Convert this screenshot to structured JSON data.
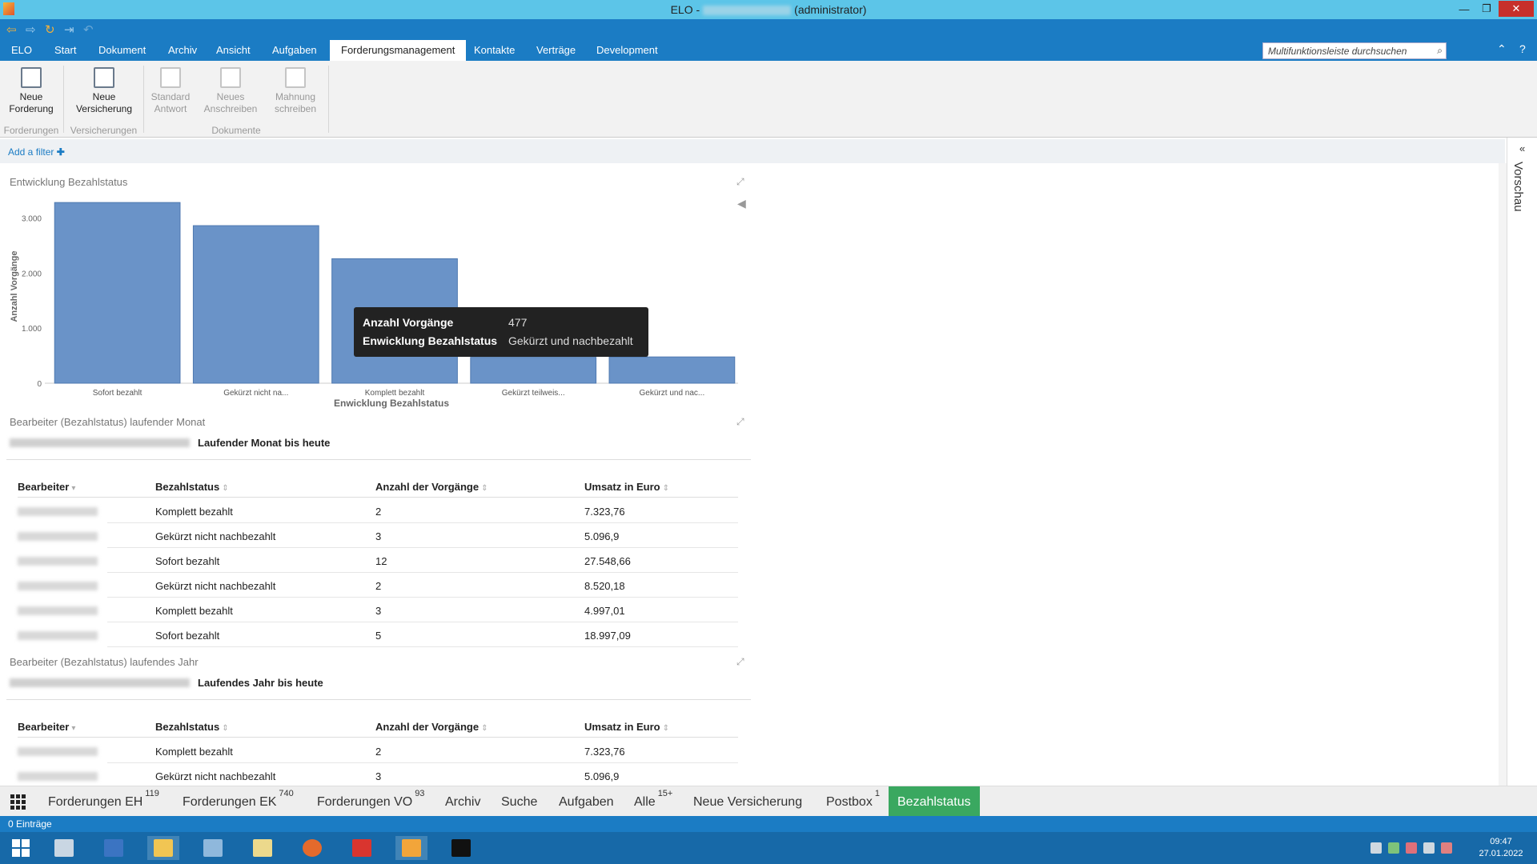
{
  "window": {
    "title_prefix": "ELO -",
    "title_suffix": "(administrator)",
    "minimize": "—",
    "restore": "❐",
    "close": "✕"
  },
  "menu": {
    "tabs": [
      "ELO",
      "Start",
      "Dokument",
      "Archiv",
      "Ansicht",
      "Aufgaben",
      "Forderungsmanagement",
      "Kontakte",
      "Verträge",
      "Development"
    ],
    "active_index": 6,
    "search_placeholder": "Multifunktionsleiste durchsuchen"
  },
  "ribbon": {
    "buttons": [
      {
        "label1": "Neue",
        "label2": "Forderung"
      },
      {
        "label1": "Neue",
        "label2": "Versicherung"
      },
      {
        "label1": "Standard",
        "label2": "Antwort"
      },
      {
        "label1": "Neues",
        "label2": "Anschreiben"
      },
      {
        "label1": "Mahnung",
        "label2": "schreiben"
      }
    ],
    "groups": [
      "Forderungen",
      "Versicherungen",
      "Dokumente"
    ]
  },
  "filter": {
    "add_label": "Add a filter",
    "plus": "✚"
  },
  "preview": {
    "label": "Vorschau",
    "chev": "«"
  },
  "chart_section": {
    "title": "Entwicklung Bezahlstatus"
  },
  "chart_data": {
    "type": "bar",
    "title": "Entwicklung Bezahlstatus",
    "xlabel": "Enwicklung Bezahlstatus",
    "ylabel": "Anzahl Vorgänge",
    "categories": [
      "Sofort bezahlt",
      "Gekürzt nicht na...",
      "Komplett bezahlt",
      "Gekürzt teilweis...",
      "Gekürzt und nac..."
    ],
    "values": [
      3280,
      2860,
      2260,
      470,
      477
    ],
    "yticks": [
      0,
      1000,
      2000,
      3000
    ],
    "ytick_labels": [
      "0",
      "1.000",
      "2.000",
      "3.000"
    ],
    "ylim": [
      0,
      3500
    ],
    "bar_color": "#6a93c8"
  },
  "tooltip": {
    "k1": "Anzahl Vorgänge",
    "v1": "477",
    "k2": "Enwicklung Bezahlstatus",
    "v2": "Gekürzt und nachbezahlt"
  },
  "month_section": {
    "title": "Bearbeiter (Bezahlstatus) laufender Monat",
    "subtitle": "Laufender Monat bis heute",
    "headers": [
      "Bearbeiter",
      "Bezahlstatus",
      "Anzahl der Vorgänge",
      "Umsatz in Euro"
    ],
    "rows": [
      {
        "status": "Komplett bezahlt",
        "count": "2",
        "amount": "7.323,76"
      },
      {
        "status": "Gekürzt nicht nachbezahlt",
        "count": "3",
        "amount": "5.096,9"
      },
      {
        "status": "Sofort bezahlt",
        "count": "12",
        "amount": "27.548,66"
      },
      {
        "status": "Gekürzt nicht nachbezahlt",
        "count": "2",
        "amount": "8.520,18"
      },
      {
        "status": "Komplett bezahlt",
        "count": "3",
        "amount": "4.997,01"
      },
      {
        "status": "Sofort bezahlt",
        "count": "5",
        "amount": "18.997,09"
      }
    ]
  },
  "year_section": {
    "title": "Bearbeiter (Bezahlstatus) laufendes Jahr",
    "subtitle": "Laufendes Jahr bis heute",
    "headers": [
      "Bearbeiter",
      "Bezahlstatus",
      "Anzahl der Vorgänge",
      "Umsatz in Euro"
    ],
    "rows": [
      {
        "status": "Komplett bezahlt",
        "count": "2",
        "amount": "7.323,76"
      },
      {
        "status": "Gekürzt nicht nachbezahlt",
        "count": "3",
        "amount": "5.096,9"
      }
    ]
  },
  "bottom_tabs": [
    {
      "label": "Forderungen EH",
      "badge": "119"
    },
    {
      "label": "Forderungen EK",
      "badge": "740"
    },
    {
      "label": "Forderungen VO",
      "badge": "93"
    },
    {
      "label": "Archiv",
      "badge": ""
    },
    {
      "label": "Suche",
      "badge": ""
    },
    {
      "label": "Aufgaben",
      "badge": ""
    },
    {
      "label": "Alle",
      "badge": "15+"
    },
    {
      "label": "Neue Versicherung",
      "badge": ""
    },
    {
      "label": "Postbox",
      "badge": "1"
    },
    {
      "label": "Bezahlstatus",
      "badge": ""
    }
  ],
  "bottom_active_index": 9,
  "status": {
    "entries": "0 Einträge"
  },
  "taskbar": {
    "time": "09:47",
    "date": "27.01.2022"
  }
}
